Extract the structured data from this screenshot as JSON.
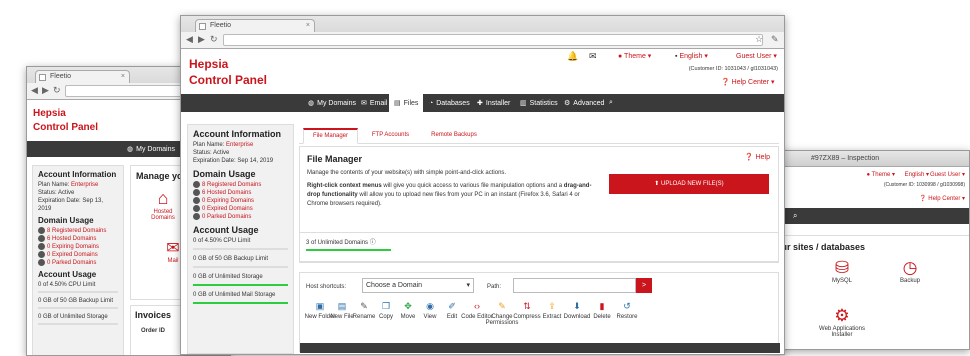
{
  "browser": {
    "tab_title": "Fleetio"
  },
  "left_win": {
    "brand1": "Hepsia",
    "brand2": "Control Panel",
    "nav_domains": "My Domains",
    "account": {
      "title": "Account Information",
      "plan_label": "Plan Name:",
      "plan_value": "Enterprise",
      "status": "Status: Active",
      "expiry": "Expiration Date: Sep 13, 2019"
    },
    "domain_usage": {
      "title": "Domain Usage",
      "items": [
        "8 Registered Domains",
        "6 Hosted Domains",
        "0 Expiring Domains",
        "0 Expired Domains",
        "0 Parked Domains"
      ]
    },
    "account_usage": {
      "title": "Account Usage",
      "items": [
        "0 of 4.50% CPU Limit",
        "0 GB of 50 GB Backup Limit",
        "0 GB of Unlimited Storage"
      ]
    },
    "manage_title": "Manage yo",
    "tiles": [
      "Hosted Domains",
      "Mail"
    ],
    "invoices": {
      "title": "Invoices",
      "col": "Order ID"
    }
  },
  "main_win": {
    "brand1": "Hepsia",
    "brand2": "Control Panel",
    "header": {
      "theme": "Theme",
      "language": "English",
      "user": "Guest User",
      "customer_id": "(Customer ID: 1031043 / gl1031043)",
      "help_center": "Help Center"
    },
    "nav": [
      "My Domains",
      "Email",
      "Files",
      "Databases",
      "Installer",
      "Statistics",
      "Advanced"
    ],
    "sidebar": {
      "account_title": "Account Information",
      "plan_label": "Plan Name:",
      "plan_value": "Enterprise",
      "status": "Status: Active",
      "expiry": "Expiration Date: Sep 14, 2019",
      "domain_title": "Domain Usage",
      "domains": [
        "8 Registered Domains",
        "6 Hosted Domains",
        "0 Expiring Domains",
        "0 Expired Domains",
        "0 Parked Domains"
      ],
      "account_usage_title": "Account Usage",
      "usage": [
        "0 of 4.50% CPU Limit",
        "0 GB of 50 GB Backup Limit",
        "0 GB of Unlimited Storage",
        "0 GB of Unlimited Mail Storage"
      ]
    },
    "tabs": [
      "File Manager",
      "FTP Accounts",
      "Remote Backups"
    ],
    "fm": {
      "title": "File Manager",
      "help": "Help",
      "desc": "Manage the contents of your website(s) with simple point-and-click actions.",
      "p1_bold": "Right-click context menus",
      "p1_rest": " will give you quick access to various file manipulation options and a ",
      "p1_bold2": "drag-and-drop functionality",
      "p1_rest2": " will allow you to upload new files from your PC in an instant (Firefox 3.6, Safari 4 or Chrome browsers required).",
      "upload": "UPLOAD NEW FILE(S)",
      "domains_used": "3 of Unlimited Domains",
      "shortcuts_label": "Host shortcuts:",
      "domain_select": "Choose a Domain",
      "path_label": "Path:",
      "go": ">"
    },
    "tools": [
      "New Folder",
      "New File",
      "Rename",
      "Copy",
      "Move",
      "View",
      "Edit",
      "Code Editor",
      "Change Permissions",
      "Compress",
      "Extract",
      "Download",
      "Delete",
      "Restore"
    ],
    "tool_colors": [
      "#2d6ea8",
      "#2d6ea8",
      "#555555",
      "#2d6ea8",
      "#2aa24a",
      "#2d6ea8",
      "#2d6ea8",
      "#c9151b",
      "#f0a020",
      "#c9151b",
      "#f0a020",
      "#2d6ea8",
      "#c9151b",
      "#2d6ea8"
    ]
  },
  "right_win": {
    "tab_title": "#97ZX89 – Inspection",
    "theme": "Theme",
    "language": "English",
    "user": "Guest User",
    "customer_id": "(Customer ID: 1030998 / gl1030998)",
    "help_center": "Help Center",
    "section_title": "our sites / databases",
    "tiles": [
      "MySQL",
      "Backup",
      "Web Applications Installer"
    ]
  }
}
